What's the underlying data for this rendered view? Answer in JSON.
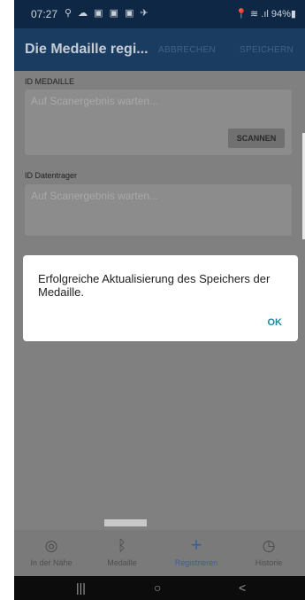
{
  "status_bar": {
    "time": "07:27",
    "left_icons": "⚲ ☁ ▣ ▣ ▣ ✈",
    "right_icons": "📍 ≋ .ıl 94%▮"
  },
  "app_bar": {
    "title": "Die Medaille regi...",
    "cancel_label": "ABBRECHEN",
    "save_label": "SPEICHERN"
  },
  "form": {
    "medal_label": "ID MEDAILLE",
    "medal_placeholder": "Auf Scanergebnis warten...",
    "scan_label": "SCANNEN",
    "carrier_label": "ID Datentrager",
    "carrier_placeholder": "Auf Scanergebnis warten..."
  },
  "dialog": {
    "message": "Erfolgreiche Aktualisierung des Speichers der Medaille.",
    "ok_label": "OK"
  },
  "bottom_nav": {
    "items": [
      {
        "label": "In der Nähe",
        "icon": "radar-icon",
        "glyph": "◎"
      },
      {
        "label": "Medaille",
        "icon": "bluetooth-icon",
        "glyph": "ᛒ"
      },
      {
        "label": "Registrieren",
        "icon": "plus-icon",
        "glyph": "+"
      },
      {
        "label": "Historie",
        "icon": "history-icon",
        "glyph": "◷"
      }
    ],
    "active": "Registrieren"
  },
  "system_nav": {
    "recents": "|||",
    "home": "○",
    "back": "<"
  },
  "colors": {
    "status_bar": "#0e2744",
    "app_bar": "#1b3c61",
    "dim_overlay": "#808080",
    "accent_ok": "#1e8a9e",
    "active_nav": "#3a5f92"
  }
}
